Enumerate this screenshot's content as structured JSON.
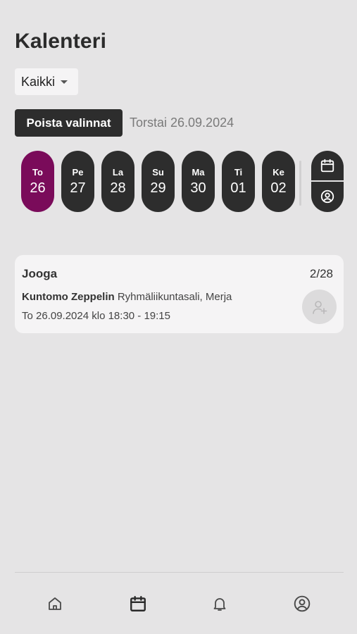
{
  "header": {
    "title": "Kalenteri"
  },
  "filter": {
    "selected": "Kaikki",
    "caret_icon": "caret-down-icon"
  },
  "toolbar": {
    "clear_label": "Poista valinnat",
    "selected_date": "Torstai 26.09.2024"
  },
  "days": [
    {
      "name": "To",
      "num": "26",
      "active": true
    },
    {
      "name": "Pe",
      "num": "27",
      "active": false
    },
    {
      "name": "La",
      "num": "28",
      "active": false
    },
    {
      "name": "Su",
      "num": "29",
      "active": false
    },
    {
      "name": "Ma",
      "num": "30",
      "active": false
    },
    {
      "name": "Ti",
      "num": "01",
      "active": false
    },
    {
      "name": "Ke",
      "num": "02",
      "active": false
    }
  ],
  "side_controls": {
    "top_icon": "calendar-icon",
    "bottom_icon": "user-circle-icon"
  },
  "event": {
    "title": "Jooga",
    "count": "2/28",
    "venue": "Kuntomo Zeppelin",
    "details": "Ryhmäliikuntasali, Merja",
    "time": "To 26.09.2024 klo 18:30 - 19:15",
    "enroll_icon": "add-user-icon"
  },
  "nav": {
    "items": [
      {
        "icon": "home-icon"
      },
      {
        "icon": "calendar-icon",
        "active": true
      },
      {
        "icon": "bell-icon"
      },
      {
        "icon": "profile-icon"
      }
    ]
  },
  "colors": {
    "accent": "#7a0b5a",
    "dark": "#2d2d2d",
    "background": "#e5e4e5",
    "card": "#f5f4f5"
  }
}
